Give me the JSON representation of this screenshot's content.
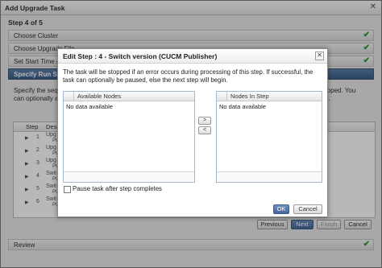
{
  "window": {
    "title": "Add Upgrade Task"
  },
  "wizard": {
    "step_header": "Step 4 of 5",
    "steps": [
      {
        "label": "Choose Cluster"
      },
      {
        "label": "Choose Upgrade File"
      },
      {
        "label": "Set Start Time & Notifications"
      },
      {
        "label": "Specify Run Sequence"
      }
    ],
    "description_left": "Specify the sequence",
    "description_left2": "can optionally also",
    "description_right": "topped. You",
    "description_right2": "es.",
    "grid_headers": {
      "step": "Step",
      "desc": "Desc"
    },
    "rows": [
      {
        "num": "1",
        "d1": "Upg",
        "d2": "PU"
      },
      {
        "num": "2",
        "d1": "Upg",
        "d2": "PU"
      },
      {
        "num": "3",
        "d1": "Upg",
        "d2": "PU"
      },
      {
        "num": "4",
        "d1": "Swit",
        "d2": "PU"
      },
      {
        "num": "5",
        "d1": "Swit",
        "d2": "PU"
      },
      {
        "num": "6",
        "d1": "Swit",
        "d2": "PU"
      }
    ],
    "buttons": {
      "previous": "Previous",
      "next": "Next",
      "finish": "Finish",
      "cancel": "Cancel"
    },
    "review_label": "Review"
  },
  "dialog": {
    "title": "Edit Step : 4 - Switch version (CUCM Publisher)",
    "message": "The task will be stopped if an error occurs during processing of this step. If successful, the task can optionally be paused, else the next step will begin.",
    "available": {
      "header": "Available Nodes",
      "empty": "No data available"
    },
    "in_step": {
      "header": "Nodes In Step",
      "empty": "No data available"
    },
    "move_right": ">",
    "move_left": "<",
    "pause_label": "Pause task after step completes",
    "ok": "OK",
    "cancel": "Cancel"
  },
  "colors": {
    "accent": "#46679a",
    "check": "#2e9a2e"
  }
}
